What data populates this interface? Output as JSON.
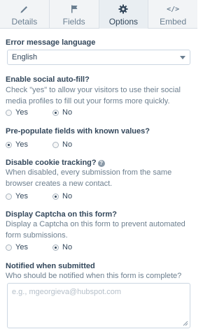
{
  "tabs": [
    {
      "label": "Details",
      "icon": "pencil-icon",
      "active": false
    },
    {
      "label": "Fields",
      "icon": "flag-icon",
      "active": false
    },
    {
      "label": "Options",
      "icon": "gear-icon",
      "active": true
    },
    {
      "label": "Embed",
      "icon": "code-icon",
      "glyph": "</>",
      "active": false
    }
  ],
  "error_language": {
    "title": "Error message language",
    "selected": "English"
  },
  "social_autofill": {
    "title": "Enable social auto-fill?",
    "description": "Check \"yes\" to allow your visitors to use their social media profiles to fill out your forms more quickly.",
    "yes": "Yes",
    "no": "No",
    "value": "No"
  },
  "prepopulate": {
    "title": "Pre-populate fields with known values?",
    "yes": "Yes",
    "no": "No",
    "value": "Yes"
  },
  "cookie_tracking": {
    "title": "Disable cookie tracking?",
    "help_glyph": "?",
    "description": "When disabled, every submission from the same browser creates a new contact.",
    "yes": "Yes",
    "no": "No",
    "value": "No"
  },
  "captcha": {
    "title": "Display Captcha on this form?",
    "description": "Display a Captcha on this form to prevent automated form submissions.",
    "yes": "Yes",
    "no": "No",
    "value": "No"
  },
  "notified": {
    "title": "Notified when submitted",
    "description": "Who should be notified when this form is complete?",
    "placeholder": "e.g., mgeorgieva@hubspot.com",
    "value": ""
  },
  "colors": {
    "text": "#33475b",
    "muted": "#6d7f8f",
    "border": "#cbd6e2",
    "active_tab": "#e9eef2"
  }
}
